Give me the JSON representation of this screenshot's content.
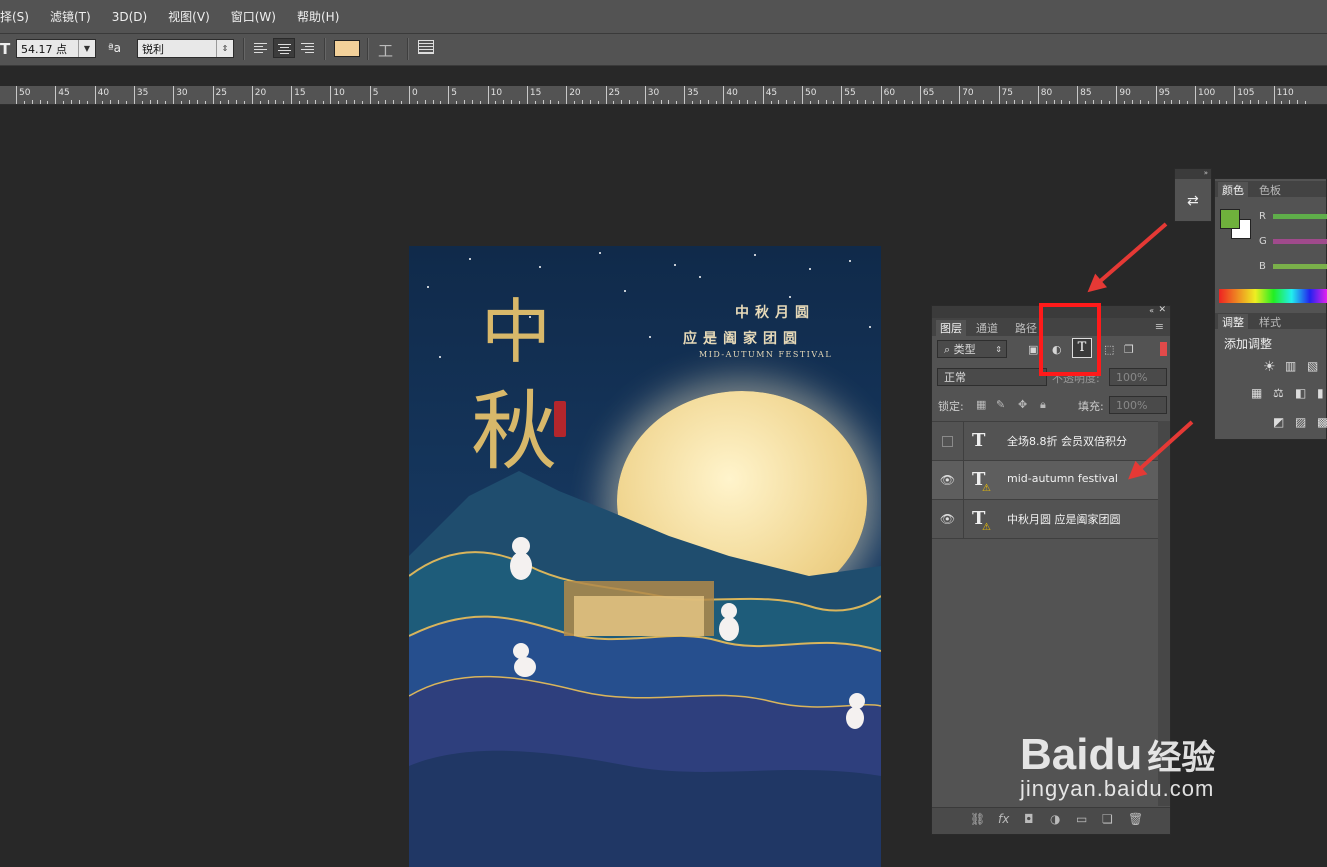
{
  "menu": [
    "择(S)",
    "滤镜(T)",
    "3D(D)",
    "视图(V)",
    "窗口(W)",
    "帮助(H)"
  ],
  "options": {
    "font_size": "54.17 点",
    "aa_label": "ªa",
    "aa_method": "锐利",
    "color": "#f3d19a"
  },
  "ruler": [
    "50",
    "45",
    "40",
    "35",
    "30",
    "25",
    "20",
    "15",
    "10",
    "5",
    "0",
    "5",
    "10",
    "15",
    "20",
    "25",
    "30",
    "35",
    "40",
    "45",
    "50",
    "55",
    "60",
    "65",
    "70",
    "75",
    "80",
    "85",
    "90",
    "95",
    "100",
    "105",
    "110"
  ],
  "poster": {
    "big1": "中",
    "big2": "秋",
    "line1": "中秋月圆",
    "line2": "应是阖家团圆",
    "line3": "MID-AUTUMN FESTIVAL"
  },
  "layers_panel": {
    "tabs": [
      "图层",
      "通道",
      "路径"
    ],
    "filter_kind": "类型",
    "blend_mode": "正常",
    "opacity_label": "不透明度:",
    "opacity_value": "100%",
    "lock_label": "锁定:",
    "fill_label": "填充:",
    "fill_value": "100%",
    "layers": [
      {
        "name": "全场8.8折 会员双倍积分",
        "visible": false
      },
      {
        "name": "mid-autumn festival",
        "visible": true
      },
      {
        "name": "中秋月圆 应是阖家团圆",
        "visible": true
      }
    ]
  },
  "color_panel": {
    "tabs": [
      "颜色",
      "色板"
    ],
    "channels": [
      "R",
      "G",
      "B"
    ],
    "fg_color": "#6fb13c"
  },
  "adjust_panel": {
    "tabs": [
      "调整",
      "样式"
    ],
    "title": "添加调整"
  },
  "watermark": {
    "brand": "Bai",
    "brand2": "du",
    "cn": "经验",
    "url": "jingyan.baidu.com"
  }
}
